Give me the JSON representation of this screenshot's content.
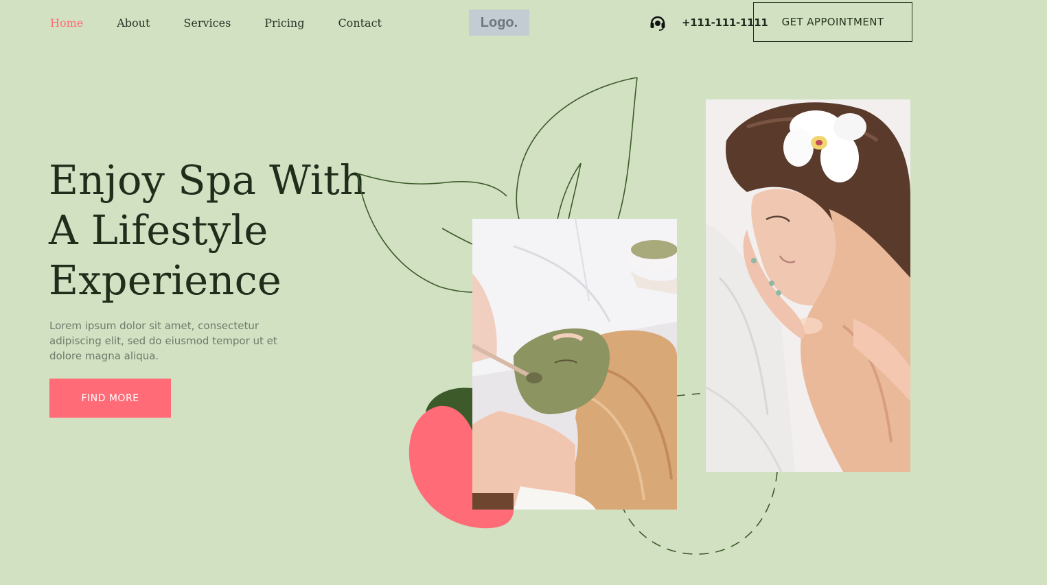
{
  "nav": {
    "items": [
      {
        "label": "Home",
        "active": true
      },
      {
        "label": "About",
        "active": false
      },
      {
        "label": "Services",
        "active": false
      },
      {
        "label": "Pricing",
        "active": false
      },
      {
        "label": "Contact",
        "active": false
      }
    ]
  },
  "logo": {
    "text": "Logo."
  },
  "contact": {
    "phone": "+111-111-1111",
    "icon": "headset-icon"
  },
  "header": {
    "appointment_label": "GET APPOINTMENT"
  },
  "hero": {
    "title_lines": [
      "Enjoy Spa With",
      "A Lifestyle",
      "Experience"
    ],
    "description": "Lorem ipsum dolor sit amet, consectetur adipiscing elit, sed do eiusmod tempor  ut et dolore magna aliqua.",
    "cta_label": "FIND MORE"
  },
  "colors": {
    "background": "#d1e1c2",
    "accent": "#ff6b77",
    "dark_green": "#3d5a2a",
    "text_dark": "#1f2d1b"
  },
  "images": [
    {
      "name": "facial-mask-photo"
    },
    {
      "name": "massage-photo"
    }
  ]
}
